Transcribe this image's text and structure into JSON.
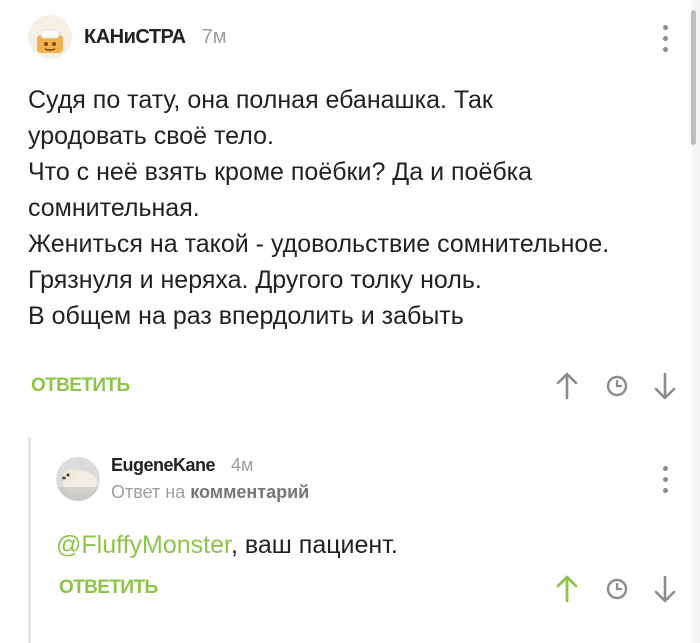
{
  "comment": {
    "author": "КАНиСТРА",
    "time": "7м",
    "lines": [
      "Судя по тату, она полная ебанашка. Так",
      "уродовать своё тело.",
      "Что с неё взять кроме поёбки? Да и поёбка",
      "сомнительная.",
      "Жениться на такой - удовольствие сомнительное.",
      "Грязнуля и неряха. Другого толку ноль.",
      "В общем на раз впердолить и забыть"
    ],
    "reply_label": "ОТВЕТИТЬ"
  },
  "reply": {
    "author": "EugeneKane",
    "time": "4м",
    "reply_to_prefix": "Ответ на",
    "reply_to_target": "комментарий",
    "mention": "@FluffyMonster",
    "text": ", ваш пациент.",
    "reply_label": "ОТВЕТИТЬ"
  },
  "colors": {
    "accent": "#8ec449",
    "icon_gray": "#8c8c8c",
    "upvote_active": "#8ec449"
  },
  "icons": {
    "comment_actions": [
      "arrow-up-icon",
      "clock-icon",
      "arrow-down-icon"
    ],
    "reply_actions": [
      "arrow-up-icon",
      "clock-icon",
      "arrow-down-icon"
    ],
    "menu": "more-vertical-icon"
  }
}
